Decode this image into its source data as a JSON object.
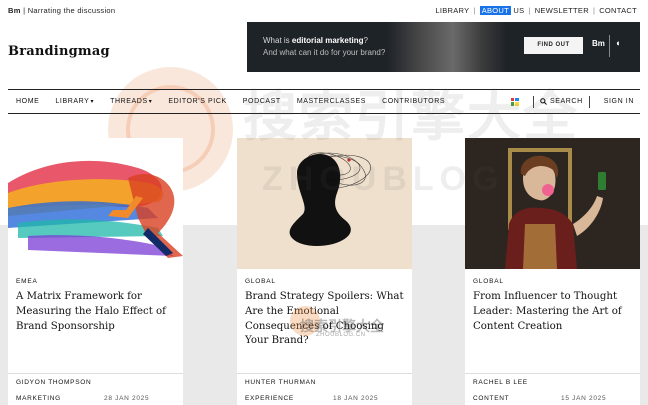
{
  "topbar": {
    "brand_short": "Bm",
    "tagline": "Narrating the discussion",
    "links": [
      "LIBRARY",
      "ABOUT US",
      "NEWSLETTER",
      "CONTACT"
    ],
    "active_link": "ABOUT"
  },
  "logo": "Brandingmag",
  "banner": {
    "line1_prefix": "What is ",
    "line1_bold": "editorial marketing",
    "line1_suffix": "?",
    "line2": "And what can it do for your brand?",
    "button": "FIND OUT",
    "brand": "Bm"
  },
  "nav": {
    "items": [
      "HOME",
      "LIBRARY",
      "THREADS",
      "EDITOR'S PICK",
      "PODCAST",
      "MASTERCLASSES",
      "CONTRIBUTORS"
    ],
    "dropdowns": [
      "LIBRARY",
      "THREADS"
    ],
    "search_label": "SEARCH",
    "signin_label": "SIGN IN",
    "grid_colors": [
      "#e53935",
      "#1e88e5",
      "#43a047",
      "#fdd835"
    ]
  },
  "cards": [
    {
      "region": "EMEA",
      "title": "A Matrix Framework for Measuring the Halo Effect of Brand Sponsorship",
      "author": "GIDYON THOMPSON",
      "category": "MARKETING",
      "date": "28 JAN 2025"
    },
    {
      "region": "GLOBAL",
      "title": "Brand Strategy Spoilers: What Are the Emotional Consequences of Choosing Your Brand?",
      "author": "HUNTER THURMAN",
      "category": "EXPERIENCE",
      "date": "18 JAN 2025"
    },
    {
      "region": "GLOBAL",
      "title": "From Influencer to Thought Leader: Mastering the Art of Content Creation",
      "author": "RACHEL B LEE",
      "category": "CONTENT",
      "date": "15 JAN 2025"
    }
  ],
  "watermark": {
    "text": "搜索引擎大全",
    "sub": "ZHOUBLOG",
    "small": "搜索引擎大全",
    "small_sub": "ZHOUBLOG.CN"
  },
  "colors": {
    "accent": "#1a73e8",
    "band": "#e9e9ea",
    "banner_bg": "#1e2328"
  }
}
